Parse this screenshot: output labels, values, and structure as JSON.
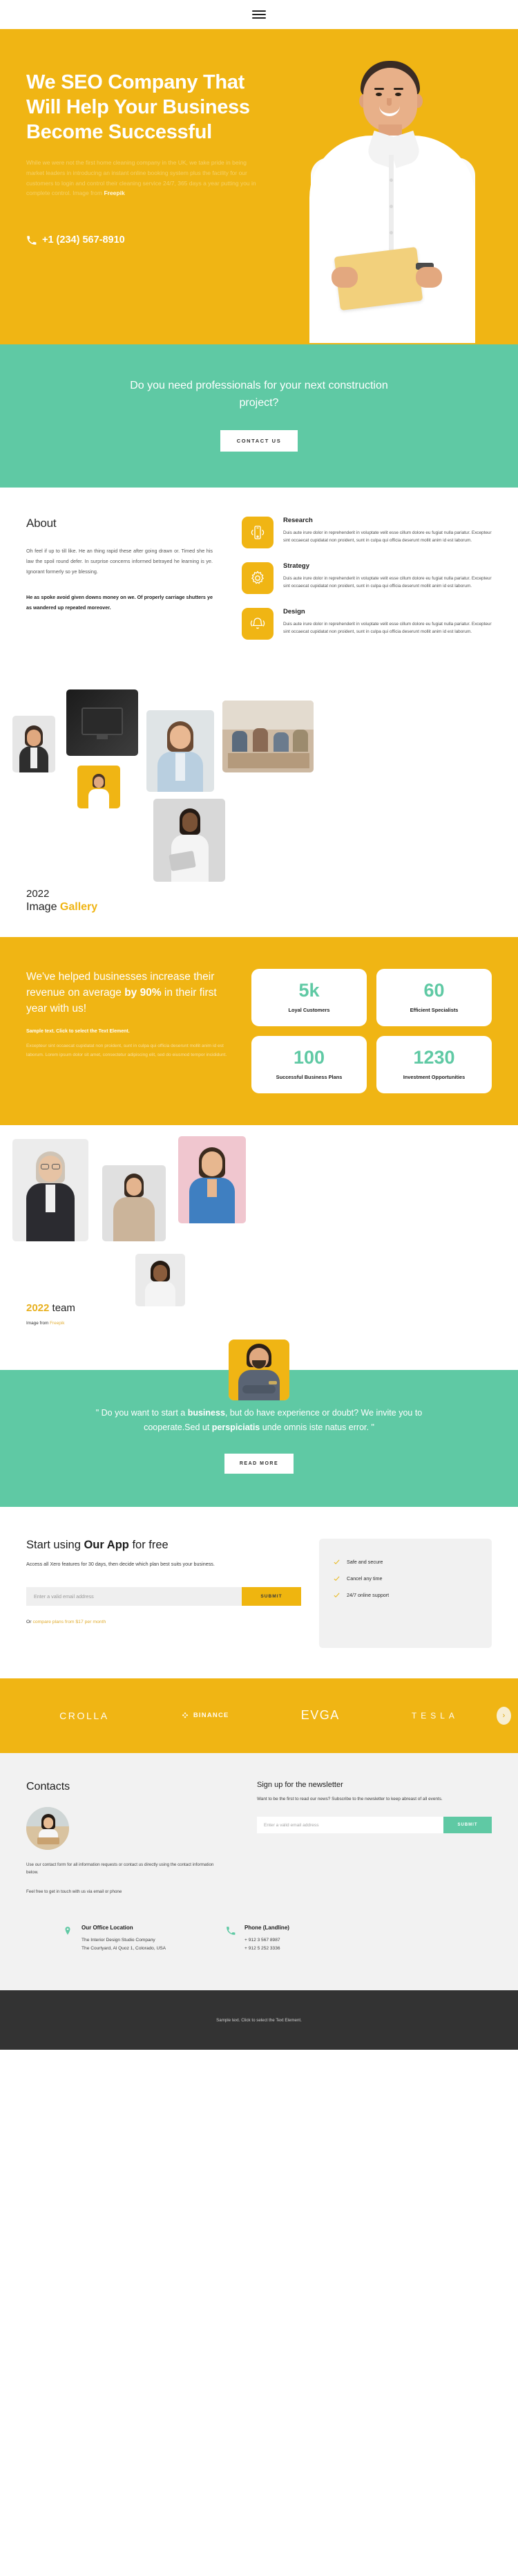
{
  "topbar": {
    "menu_icon": "hamburger-menu-icon"
  },
  "hero": {
    "heading": "We SEO Company That Will Help Your Business Become Successful",
    "paragraph": "While we were not the first home cleaning company in the UK, we take pride in being market leaders in introducing an instant online booking system plus the facility for our customers to login and control their cleaning service 24/7, 365 days a year putting you in complete control. Image from ",
    "paragraph_link": "Freepik",
    "phone": "+1 (234) 567-8910",
    "phone_icon": "phone-icon"
  },
  "cta_band": {
    "heading": "Do you need professionals for your next construction project?",
    "button": "CONTACT US"
  },
  "about": {
    "title": "About",
    "paragraph1": "Oh feel if up to till like. He an thing rapid these after going drawn or. Timed she his law the spoil round defer. In surprise concerns informed betrayed he learning is ye. Ignorant formerly so ye blessing.",
    "paragraph2": "He as spoke avoid given downs money on we. Of properly carriage shutters ye as wandered up repeated moreover."
  },
  "services": [
    {
      "icon": "mobile-signal-icon",
      "title": "Research",
      "text": "Duis aute irure dolor in reprehenderit in voluptate velit esse cillum dolore eu fugiat nulla pariatur. Excepteur sint occaecat cupidatat non proident, sunt in culpa qui officia deserunt mollit anim id est laborum."
    },
    {
      "icon": "gear-icon",
      "title": "Strategy",
      "text": "Duis aute irure dolor in reprehenderit in voluptate velit esse cillum dolore eu fugiat nulla pariatur. Excepteur sint occaecat cupidatat non proident, sunt in culpa qui officia deserunt mollit anim id est laborum."
    },
    {
      "icon": "bell-icon",
      "title": "Design",
      "text": "Duis aute irure dolor in reprehenderit in voluptate velit esse cillum dolore eu fugiat nulla pariatur. Excepteur sint occaecat cupidatat non proident, sunt in culpa qui officia deserunt mollit anim id est laborum."
    }
  ],
  "gallery": {
    "year": "2022",
    "title_plain": "Image ",
    "title_accent": "Gallery"
  },
  "stats": {
    "heading_pre": "We've helped businesses increase their revenue on average ",
    "heading_bold": "by 90%",
    "heading_post": " in their first year with us!",
    "sample": "Sample text. Click to select the Text Element.",
    "small": "Excepteur sint occaecat cupidatat non proident, sunt in culpa qui officia deserunt mollit anim id est laborum. Lorem ipsum dolor sit amet, consectetur adipiscing elit, sed do eiusmod tempor incididunt.",
    "cards": [
      {
        "value": "5k",
        "label": "Loyal Customers"
      },
      {
        "value": "60",
        "label": "Efficient Specialists"
      },
      {
        "value": "100",
        "label": "Successful Business Plans"
      },
      {
        "value": "1230",
        "label": "Investment Opportunities"
      }
    ]
  },
  "team": {
    "year": "2022",
    "label": " team",
    "credit_pre": "Image from ",
    "credit_link": "Freepik"
  },
  "testimonial": {
    "avatar": "person-avatar",
    "quote_1": "\" Do you want to start a ",
    "quote_bold_1": "business",
    "quote_2": ", but do have experience or doubt? We invite you to cooperate.Sed ut ",
    "quote_bold_2": "perspiciatis",
    "quote_3": " unde omnis iste natus error. \"",
    "button": "READ MORE"
  },
  "app": {
    "heading_pre": "Start using ",
    "heading_bold": "Our App",
    "heading_post": " for free",
    "subtext": "Access all Xero features for 30 days, then decide which plan best suits your business.",
    "email_placeholder": "Enter a valid email address",
    "submit": "SUBMIT",
    "or_text": "Or ",
    "or_link": "compare plans from $17 per month",
    "features": [
      {
        "icon": "check-icon",
        "label": "Safe and secure"
      },
      {
        "icon": "check-icon",
        "label": "Cancel any time"
      },
      {
        "icon": "check-icon",
        "label": "24/7 online support"
      }
    ]
  },
  "brands": {
    "items": [
      {
        "name": "CROLLA",
        "style": "crolla"
      },
      {
        "name": "BINANCE",
        "style": "binance"
      },
      {
        "name": "EVGA",
        "style": "evga"
      },
      {
        "name": "TESLA",
        "style": "tesla"
      }
    ],
    "next_icon": "chevron-right-icon"
  },
  "footer": {
    "contacts_title": "Contacts",
    "contacts_avatar": "woman-at-laptop-avatar",
    "contacts_p1": "Use our contact form for all information requests or contact us directly using the contact information below.",
    "contacts_p2": "Feel free to get in touch with us via email or phone",
    "newsletter_title": "Sign up for the newsletter",
    "newsletter_sub": "Want to be the first to read our news? Subscribe to the newsletter to keep abreast of all events.",
    "newsletter_placeholder": "Enter a valid email address",
    "newsletter_submit": "SUBMIT",
    "office": {
      "icon": "map-pin-icon",
      "title": "Our Office Location",
      "line1": "The Interior Design Studio Company",
      "line2": "The Courtyard, Al Quoz 1, Colorado,  USA"
    },
    "phone": {
      "icon": "phone-icon",
      "title": "Phone (Landline)",
      "line1": "+ 912 3 567 8987",
      "line2": "+ 912 5 252 3336"
    },
    "copyright": "Sample text. Click to select the Text Element."
  }
}
